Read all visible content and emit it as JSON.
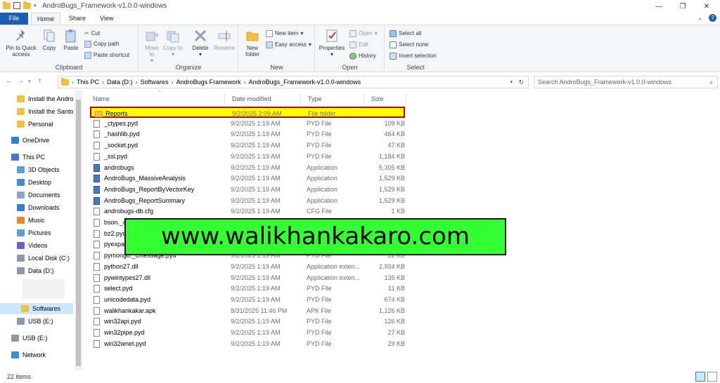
{
  "window": {
    "title": "AndroBugs_Framework-v1.0.0-windows",
    "controls": {
      "minimize": "—",
      "maximize": "❐",
      "close": "✕"
    }
  },
  "tabs": {
    "file": "File",
    "home": "Home",
    "share": "Share",
    "view": "View"
  },
  "ribbon": {
    "clipboard": {
      "label": "Clipboard",
      "pin": "Pin to Quick access",
      "copy": "Copy",
      "paste": "Paste",
      "cut": "Cut",
      "copy_path": "Copy path",
      "paste_shortcut": "Paste shortcut"
    },
    "organize": {
      "label": "Organize",
      "move_to": "Move to",
      "copy_to": "Copy to",
      "delete": "Delete",
      "rename": "Rename"
    },
    "new": {
      "label": "New",
      "new_folder": "New folder",
      "new_item": "New item",
      "easy_access": "Easy access"
    },
    "open": {
      "label": "Open",
      "properties": "Properties",
      "open": "Open",
      "edit": "Edit",
      "history": "History"
    },
    "select": {
      "label": "Select",
      "select_all": "Select all",
      "select_none": "Select none",
      "invert": "Invert selection"
    }
  },
  "address": {
    "crumbs": [
      "This PC",
      "Data (D:)",
      "Softwares",
      "AndroBugs Framework",
      "AndroBugs_Framework-v1.0.0-windows"
    ],
    "search_placeholder": "Search AndroBugs_Framework-v1.0.0-windows"
  },
  "nav": {
    "items": [
      {
        "label": "Install the Andro",
        "icon": "folder-icon"
      },
      {
        "label": "Install the Santol",
        "icon": "folder-icon"
      },
      {
        "label": "Personal",
        "icon": "folder-icon"
      },
      {
        "label": "OneDrive",
        "icon": "cloud-icon"
      },
      {
        "label": "This PC",
        "icon": "computer-icon"
      },
      {
        "label": "3D Objects",
        "icon": "cube-icon"
      },
      {
        "label": "Desktop",
        "icon": "desktop-icon"
      },
      {
        "label": "Documents",
        "icon": "documents-icon"
      },
      {
        "label": "Downloads",
        "icon": "download-icon"
      },
      {
        "label": "Music",
        "icon": "music-icon"
      },
      {
        "label": "Pictures",
        "icon": "pictures-icon"
      },
      {
        "label": "Videos",
        "icon": "videos-icon"
      },
      {
        "label": "Local Disk (C:)",
        "icon": "disk-icon"
      },
      {
        "label": "Data (D:)",
        "icon": "disk-icon"
      },
      {
        "label": "Softwares",
        "icon": "folder-icon"
      },
      {
        "label": "USB (E:)",
        "icon": "usb-icon"
      },
      {
        "label": "USB (E:)",
        "icon": "usb-icon"
      },
      {
        "label": "Network",
        "icon": "network-icon"
      }
    ]
  },
  "columns": {
    "name": "Name",
    "date": "Date modified",
    "type": "Type",
    "size": "Size"
  },
  "files": [
    {
      "name": "Reports",
      "date": "9/2/2025 2:09 AM",
      "type": "File folder",
      "size": "",
      "kind": "folder"
    },
    {
      "name": "_ctypes.pyd",
      "date": "9/2/2025 1:19 AM",
      "type": "PYD File",
      "size": "109 KB",
      "kind": "file"
    },
    {
      "name": "_hashlib.pyd",
      "date": "9/2/2025 1:19 AM",
      "type": "PYD File",
      "size": "464 KB",
      "kind": "file"
    },
    {
      "name": "_socket.pyd",
      "date": "9/2/2025 1:19 AM",
      "type": "PYD File",
      "size": "47 KB",
      "kind": "file"
    },
    {
      "name": "_ssl.pyd",
      "date": "9/2/2025 1:19 AM",
      "type": "PYD File",
      "size": "1,184 KB",
      "kind": "file"
    },
    {
      "name": "androbugs",
      "date": "9/2/2025 1:19 AM",
      "type": "Application",
      "size": "5,305 KB",
      "kind": "app"
    },
    {
      "name": "AndroBugs_MassiveAnalysis",
      "date": "9/2/2025 1:19 AM",
      "type": "Application",
      "size": "1,529 KB",
      "kind": "app"
    },
    {
      "name": "AndroBugs_ReportByVectorKey",
      "date": "9/2/2025 1:19 AM",
      "type": "Application",
      "size": "1,529 KB",
      "kind": "app"
    },
    {
      "name": "AndroBugs_ReportSummary",
      "date": "9/2/2025 1:19 AM",
      "type": "Application",
      "size": "1,529 KB",
      "kind": "app"
    },
    {
      "name": "androbugs-db.cfg",
      "date": "9/2/2025 1:19 AM",
      "type": "CFG File",
      "size": "1 KB",
      "kind": "file"
    },
    {
      "name": "bson._c",
      "date": "",
      "type": "",
      "size": "",
      "kind": "file"
    },
    {
      "name": "bz2.pyd",
      "date": "",
      "type": "",
      "size": "",
      "kind": "file"
    },
    {
      "name": "pyexpat",
      "date": "",
      "type": "",
      "size": "",
      "kind": "file"
    },
    {
      "name": "pymongo._cmessage.pyd",
      "date": "9/2/2025 1:19 AM",
      "type": "PYD File",
      "size": "22 KB",
      "kind": "file"
    },
    {
      "name": "python27.dll",
      "date": "9/2/2025 1:19 AM",
      "type": "Application exten...",
      "size": "2,934 KB",
      "kind": "file"
    },
    {
      "name": "pywintypes27.dll",
      "date": "9/2/2025 1:19 AM",
      "type": "Application exten...",
      "size": "135 KB",
      "kind": "file"
    },
    {
      "name": "select.pyd",
      "date": "9/2/2025 1:19 AM",
      "type": "PYD File",
      "size": "11 KB",
      "kind": "file"
    },
    {
      "name": "unicodedata.pyd",
      "date": "9/2/2025 1:19 AM",
      "type": "PYD File",
      "size": "674 KB",
      "kind": "file"
    },
    {
      "name": "walikhankakar.apk",
      "date": "8/31/2025 11:46 PM",
      "type": "APK File",
      "size": "1,126 KB",
      "kind": "file"
    },
    {
      "name": "win32api.pyd",
      "date": "9/2/2025 1:19 AM",
      "type": "PYD File",
      "size": "126 KB",
      "kind": "file"
    },
    {
      "name": "win32pipe.pyd",
      "date": "9/2/2025 1:19 AM",
      "type": "PYD File",
      "size": "27 KB",
      "kind": "file"
    },
    {
      "name": "win32wnet.pyd",
      "date": "9/2/2025 1:19 AM",
      "type": "PYD File",
      "size": "29 KB",
      "kind": "file"
    }
  ],
  "watermark": "www.walikhankakaro.com",
  "status": {
    "count": "22 items"
  },
  "colors": {
    "accent": "#1a5fb4",
    "highlight": "#ffff00",
    "highlight_border": "#c00000",
    "watermark_bg": "#33ff33"
  }
}
